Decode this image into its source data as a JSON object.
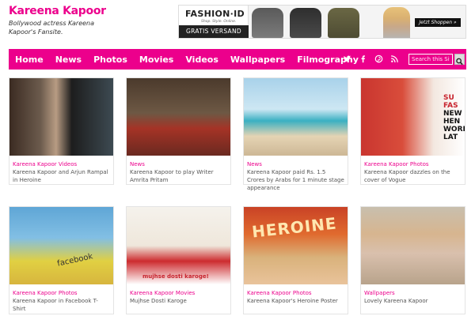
{
  "site": {
    "title": "Kareena Kapoor",
    "description": "Bollywood actress Kareena Kapoor's Fansite."
  },
  "ad": {
    "brand": "FASHION·ID",
    "tagline": "Shop. Style. Online.",
    "gratis": "GRATIS VERSAND",
    "cta": "Jetzt Shoppen »"
  },
  "nav": {
    "links": [
      "Home",
      "News",
      "Photos",
      "Movies",
      "Videos",
      "Wallpapers",
      "Filmography"
    ],
    "icons": [
      "twitter-icon",
      "facebook-icon",
      "pinterest-icon",
      "rss-icon"
    ],
    "search_placeholder": "Search this Site...",
    "accent": "#ec008c"
  },
  "cards": [
    {
      "category": "Kareena Kapoor Videos",
      "title": "Kareena Kapoor and Arjun Rampal in Heroine"
    },
    {
      "category": "News",
      "title": "Kareena Kapoor to play Writer Amrita Pritam"
    },
    {
      "category": "News",
      "title": "Kareena Kapoor paid Rs. 1.5 Crores by Arabs for 1 minute stage appearance"
    },
    {
      "category": "Kareena Kapoor Photos",
      "title": "Kareena Kapoor dazzles on the cover of Vogue"
    },
    {
      "category": "Kareena Kapoor Photos",
      "title": "Kareena Kapoor in Facebook T-Shirt"
    },
    {
      "category": "Kareena Kapoor Movies",
      "title": "Mujhse Dosti Karoge"
    },
    {
      "category": "Kareena Kapoor Photos",
      "title": "Kareena Kapoor's Heroine Poster"
    },
    {
      "category": "Wallpapers",
      "title": "Lovely Kareena Kapoor"
    }
  ],
  "thumb_text": {
    "vogue_cover": [
      "SU",
      "FAS",
      "NEW",
      "HEN",
      "WORK",
      "LAT"
    ],
    "facebook_shirt": "facebook",
    "movie_caption": "mujhse dosti karoge!",
    "heroine_poster": "HEROINE"
  }
}
